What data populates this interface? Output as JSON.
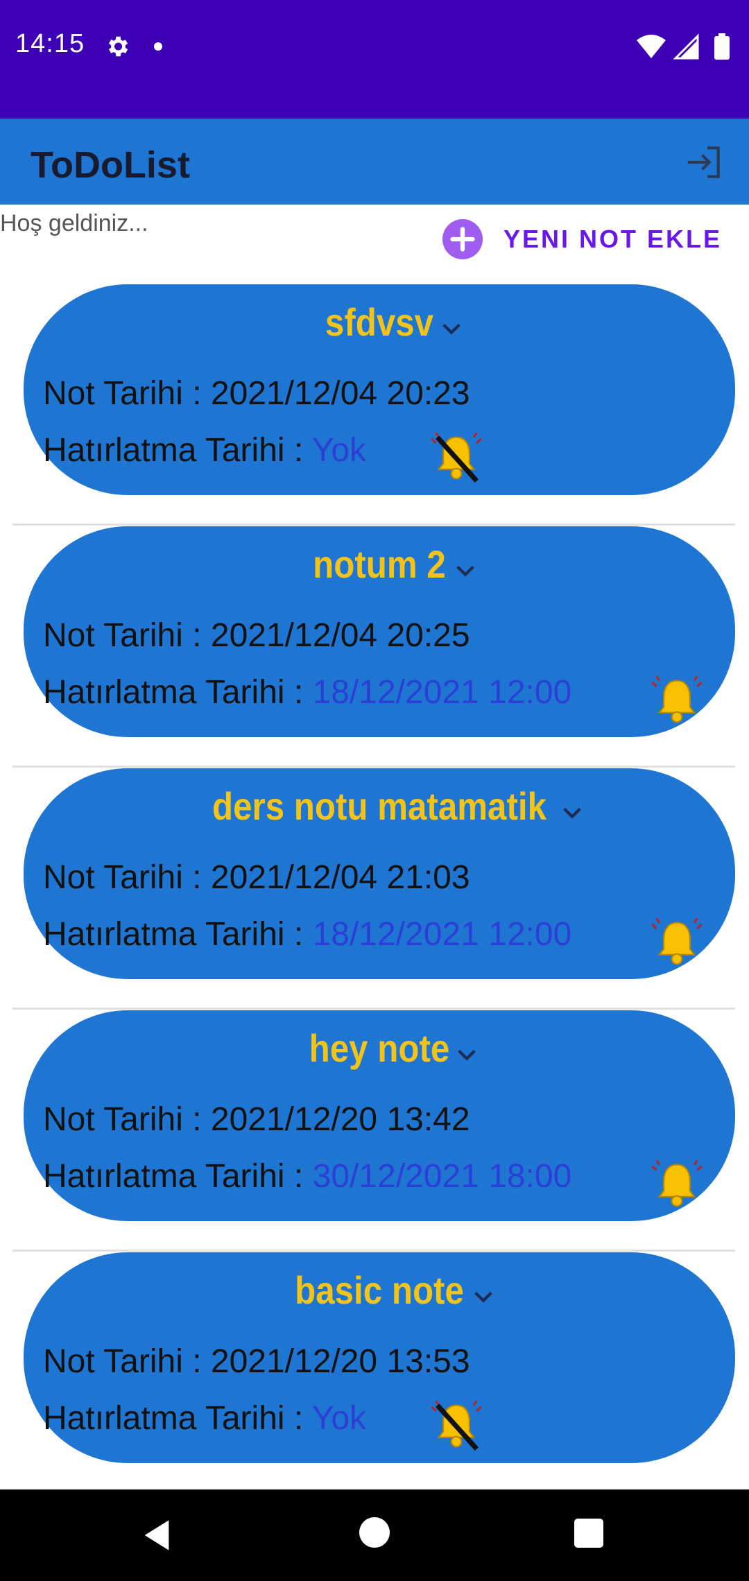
{
  "status_bar": {
    "time": "14:15"
  },
  "app_bar": {
    "title": "ToDoList"
  },
  "welcome_text": "Hoş geldiniz...",
  "add_note_label": "YENI NOT EKLE",
  "colors": {
    "status_bar": "#3f00b5",
    "app_bar": "#1f76d2",
    "card": "#1f76d2",
    "title": "#f2c318",
    "reminder_value": "#2b3fd6",
    "accent": "#6a18e8"
  },
  "notes": [
    {
      "title": "sfdvsv",
      "date_label": "Not Tarihi : ",
      "date": "2021/12/04 20:23",
      "reminder_label": "Hatırlatma Tarihi : ",
      "reminder": "Yok",
      "bell_icon": "bell-off-icon"
    },
    {
      "title": "notum 2",
      "date_label": "Not Tarihi : ",
      "date": "2021/12/04 20:25",
      "reminder_label": "Hatırlatma Tarihi : ",
      "reminder": "18/12/2021 12:00",
      "bell_icon": "bell-ringing-icon"
    },
    {
      "title": "ders notu matamatik",
      "date_label": "Not Tarihi : ",
      "date": "2021/12/04 21:03",
      "reminder_label": "Hatırlatma Tarihi : ",
      "reminder": "18/12/2021 12:00",
      "bell_icon": "bell-ringing-icon"
    },
    {
      "title": "hey note",
      "date_label": "Not Tarihi : ",
      "date": "2021/12/20 13:42",
      "reminder_label": "Hatırlatma Tarihi : ",
      "reminder": "30/12/2021 18:00",
      "bell_icon": "bell-ringing-icon"
    },
    {
      "title": "basic note",
      "date_label": "Not Tarihi : ",
      "date": "2021/12/20 13:53",
      "reminder_label": "Hatırlatma Tarihi : ",
      "reminder": "Yok",
      "bell_icon": "bell-off-icon"
    }
  ]
}
